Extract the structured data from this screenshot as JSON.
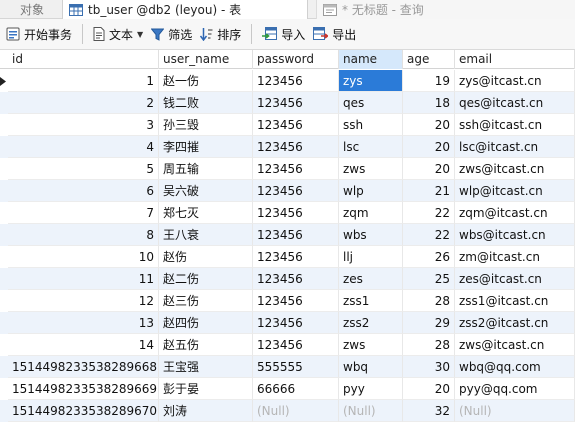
{
  "tabs": {
    "objects": "对象",
    "active": "tb_user @db2 (leyou) - 表",
    "query": "* 无标题 - 查询"
  },
  "toolbar": {
    "begin_transaction": "开始事务",
    "text": "文本",
    "filter": "筛选",
    "sort": "排序",
    "import": "导入",
    "export": "导出"
  },
  "grid": {
    "columns": [
      "id",
      "user_name",
      "password",
      "name",
      "age",
      "email"
    ],
    "selected_column": "name",
    "null_label": "(Null)",
    "rows": [
      {
        "id": "1",
        "user_name": "赵一伤",
        "password": "123456",
        "name": "zys",
        "age": "19",
        "email": "zys@itcast.cn"
      },
      {
        "id": "2",
        "user_name": "钱二败",
        "password": "123456",
        "name": "qes",
        "age": "18",
        "email": "qes@itcast.cn"
      },
      {
        "id": "3",
        "user_name": "孙三毁",
        "password": "123456",
        "name": "ssh",
        "age": "20",
        "email": "ssh@itcast.cn"
      },
      {
        "id": "4",
        "user_name": "李四摧",
        "password": "123456",
        "name": "lsc",
        "age": "20",
        "email": "lsc@itcast.cn"
      },
      {
        "id": "5",
        "user_name": "周五输",
        "password": "123456",
        "name": "zws",
        "age": "20",
        "email": "zws@itcast.cn"
      },
      {
        "id": "6",
        "user_name": "吴六破",
        "password": "123456",
        "name": "wlp",
        "age": "21",
        "email": "wlp@itcast.cn"
      },
      {
        "id": "7",
        "user_name": "郑七灭",
        "password": "123456",
        "name": "zqm",
        "age": "22",
        "email": "zqm@itcast.cn"
      },
      {
        "id": "8",
        "user_name": "王八衰",
        "password": "123456",
        "name": "wbs",
        "age": "22",
        "email": "wbs@itcast.cn"
      },
      {
        "id": "10",
        "user_name": "赵伤",
        "password": "123456",
        "name": "llj",
        "age": "26",
        "email": "zm@itcast.cn"
      },
      {
        "id": "11",
        "user_name": "赵二伤",
        "password": "123456",
        "name": "zes",
        "age": "25",
        "email": "zes@itcast.cn"
      },
      {
        "id": "12",
        "user_name": "赵三伤",
        "password": "123456",
        "name": "zss1",
        "age": "28",
        "email": "zss1@itcast.cn"
      },
      {
        "id": "13",
        "user_name": "赵四伤",
        "password": "123456",
        "name": "zss2",
        "age": "29",
        "email": "zss2@itcast.cn"
      },
      {
        "id": "14",
        "user_name": "赵五伤",
        "password": "123456",
        "name": "zws",
        "age": "28",
        "email": "zws@itcast.cn"
      },
      {
        "id": "1514498233538289668",
        "user_name": "王宝强",
        "password": "555555",
        "name": "wbq",
        "age": "30",
        "email": "wbq@qq.com"
      },
      {
        "id": "1514498233538289669",
        "user_name": "彭于晏",
        "password": "66666",
        "name": "pyy",
        "age": "20",
        "email": "pyy@qq.com"
      },
      {
        "id": "1514498233538289670",
        "user_name": "刘涛",
        "password": null,
        "name": null,
        "age": "32",
        "email": null
      }
    ]
  }
}
